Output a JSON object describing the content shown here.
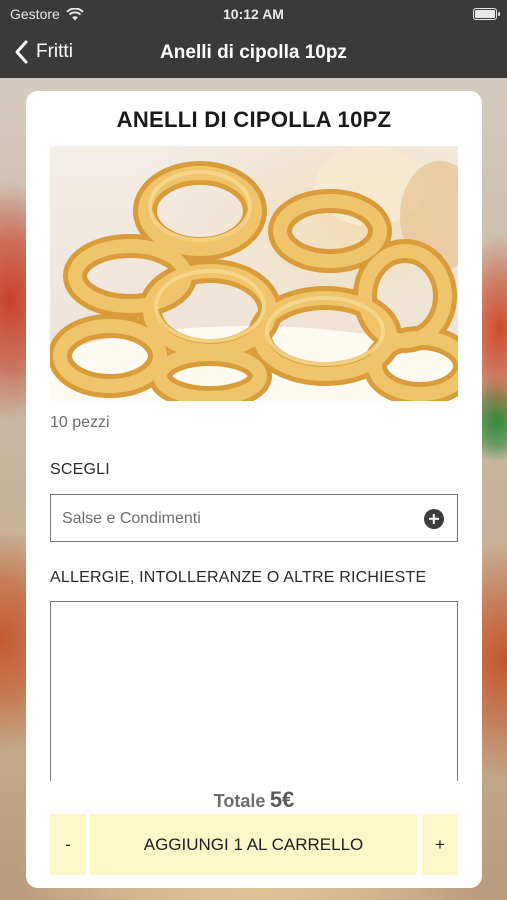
{
  "status_bar": {
    "carrier": "Gestore",
    "time": "10:12 AM"
  },
  "nav": {
    "back_label": "Fritti",
    "title": "Anelli di cipolla 10pz"
  },
  "product": {
    "title": "ANELLI DI CIPOLLA 10PZ",
    "image_alt": "Anelli di cipolla",
    "description": "10 pezzi"
  },
  "choose": {
    "label": "SCEGLI",
    "placeholder": "Salse e Condimenti"
  },
  "notes": {
    "label": "ALLERGIE, INTOLLERANZE O ALTRE RICHIESTE",
    "value": ""
  },
  "total": {
    "label": "Totale",
    "value": "5€"
  },
  "cart": {
    "minus_label": "-",
    "add_label": "AGGIUNGI 1 AL CARRELLO",
    "plus_label": "+"
  },
  "colors": {
    "bar_bg": "#3a3a3a",
    "button_bg": "#fbf7c8"
  }
}
